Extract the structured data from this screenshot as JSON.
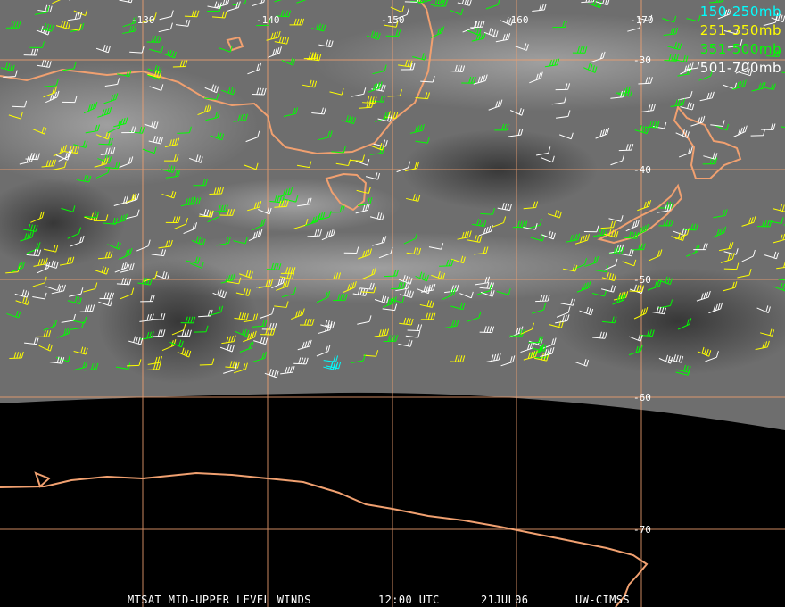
{
  "grid": {
    "longitude_labels": [
      "-130",
      "-140",
      "-150",
      "-160",
      "-170"
    ],
    "latitude_labels": [
      "-30",
      "-40",
      "-50",
      "-60",
      "-70"
    ],
    "color": "#f0a070"
  },
  "legend": [
    {
      "label": "150-250mb",
      "color": "#00ffff"
    },
    {
      "label": "251-350mb",
      "color": "#ffff00"
    },
    {
      "label": "351-500mb",
      "color": "#00ff00"
    },
    {
      "label": "501-700mb",
      "color": "#ffffff"
    }
  ],
  "footer": {
    "satellite": "MTSAT MID-UPPER LEVEL WINDS",
    "time": "12:00 UTC",
    "date": "21JUL06",
    "source": "UW-CIMSS"
  },
  "colors": {
    "coastline": "#f0a070",
    "background": "#000000"
  }
}
